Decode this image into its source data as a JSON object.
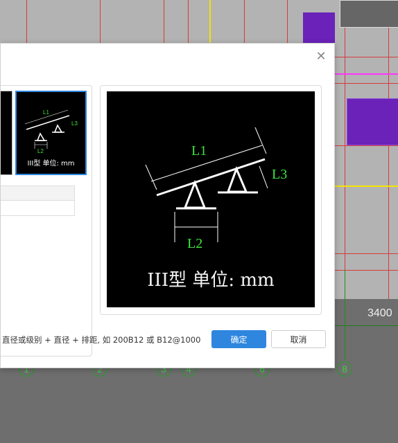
{
  "cad": {
    "dimension_label": "3400",
    "axis_labels": [
      "1",
      "2",
      "3",
      "4",
      "6",
      "8"
    ]
  },
  "dialog": {
    "close_icon": "close-icon",
    "thumbnail": {
      "caption": "III型 单位: mm",
      "labels": {
        "l1": "L1",
        "l2": "L2",
        "l3": "L3"
      }
    },
    "preview": {
      "caption": "III型 单位: mm",
      "labels": {
        "l1": "L1",
        "l2": "L2",
        "l3": "L3"
      }
    },
    "hint": "直径或级别 + 直径 + 排距, 如 200B12 或 B12@1000",
    "ok_label": "确定",
    "cancel_label": "取消"
  },
  "colors": {
    "accent": "#2e86de",
    "drawing_label": "#3ee63e",
    "grid_red": "#d83a3a",
    "purple": "#6a22b8"
  }
}
